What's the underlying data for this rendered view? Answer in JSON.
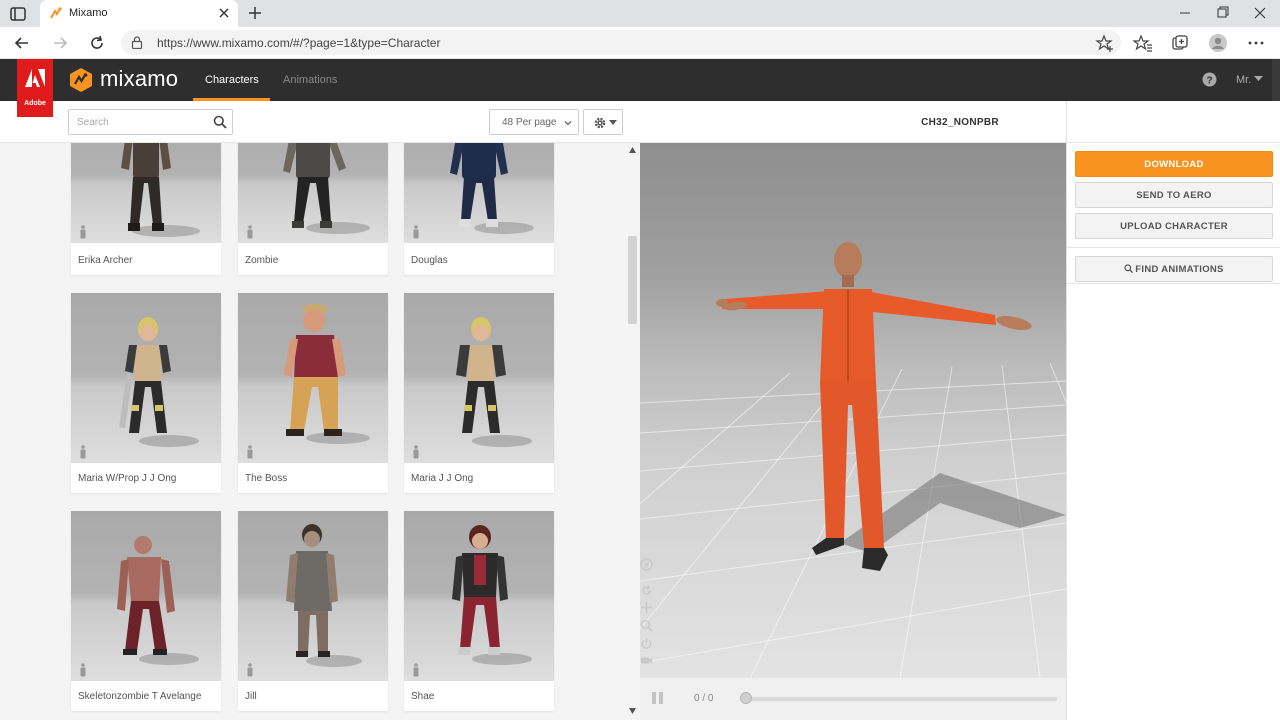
{
  "browser": {
    "tab_title": "Mixamo",
    "url": "https://www.mixamo.com/#/?page=1&type=Character"
  },
  "header": {
    "adobe_label": "Adobe",
    "logo_text": "mixamo",
    "nav": {
      "characters": "Characters",
      "animations": "Animations"
    },
    "user": "Mr."
  },
  "toolbar": {
    "search_placeholder": "Search",
    "per_page": "48 Per page"
  },
  "characters": [
    {
      "name": "Erika Archer"
    },
    {
      "name": "Zombie"
    },
    {
      "name": "Douglas"
    },
    {
      "name": "Maria W/Prop J J Ong"
    },
    {
      "name": "The Boss"
    },
    {
      "name": "Maria J J Ong"
    },
    {
      "name": "Skeletonzombie T Avelange"
    },
    {
      "name": "Jill"
    },
    {
      "name": "Shae"
    }
  ],
  "viewer": {
    "title": "CH32_NONPBR",
    "frame_counter": "0 / 0",
    "timeline_progress": 0
  },
  "actions": {
    "download": "DOWNLOAD",
    "send_to_aero": "SEND TO AERO",
    "upload_character": "UPLOAD CHARACTER",
    "find_animations": "FIND ANIMATIONS"
  },
  "colors": {
    "accent": "#f7931e",
    "header_bg": "#2e2e2e",
    "adobe_red": "#e11b1b",
    "jumpsuit": "#e85a2a"
  }
}
